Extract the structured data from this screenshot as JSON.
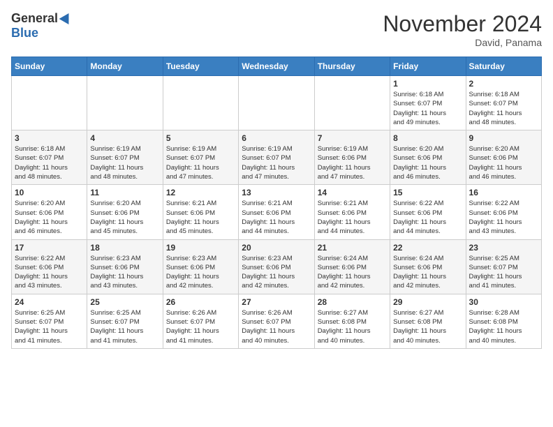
{
  "header": {
    "logo_general": "General",
    "logo_blue": "Blue",
    "month_title": "November 2024",
    "location": "David, Panama"
  },
  "days_of_week": [
    "Sunday",
    "Monday",
    "Tuesday",
    "Wednesday",
    "Thursday",
    "Friday",
    "Saturday"
  ],
  "weeks": [
    [
      {
        "day": "",
        "info": ""
      },
      {
        "day": "",
        "info": ""
      },
      {
        "day": "",
        "info": ""
      },
      {
        "day": "",
        "info": ""
      },
      {
        "day": "",
        "info": ""
      },
      {
        "day": "1",
        "info": "Sunrise: 6:18 AM\nSunset: 6:07 PM\nDaylight: 11 hours\nand 49 minutes."
      },
      {
        "day": "2",
        "info": "Sunrise: 6:18 AM\nSunset: 6:07 PM\nDaylight: 11 hours\nand 48 minutes."
      }
    ],
    [
      {
        "day": "3",
        "info": "Sunrise: 6:18 AM\nSunset: 6:07 PM\nDaylight: 11 hours\nand 48 minutes."
      },
      {
        "day": "4",
        "info": "Sunrise: 6:19 AM\nSunset: 6:07 PM\nDaylight: 11 hours\nand 48 minutes."
      },
      {
        "day": "5",
        "info": "Sunrise: 6:19 AM\nSunset: 6:07 PM\nDaylight: 11 hours\nand 47 minutes."
      },
      {
        "day": "6",
        "info": "Sunrise: 6:19 AM\nSunset: 6:07 PM\nDaylight: 11 hours\nand 47 minutes."
      },
      {
        "day": "7",
        "info": "Sunrise: 6:19 AM\nSunset: 6:06 PM\nDaylight: 11 hours\nand 47 minutes."
      },
      {
        "day": "8",
        "info": "Sunrise: 6:20 AM\nSunset: 6:06 PM\nDaylight: 11 hours\nand 46 minutes."
      },
      {
        "day": "9",
        "info": "Sunrise: 6:20 AM\nSunset: 6:06 PM\nDaylight: 11 hours\nand 46 minutes."
      }
    ],
    [
      {
        "day": "10",
        "info": "Sunrise: 6:20 AM\nSunset: 6:06 PM\nDaylight: 11 hours\nand 46 minutes."
      },
      {
        "day": "11",
        "info": "Sunrise: 6:20 AM\nSunset: 6:06 PM\nDaylight: 11 hours\nand 45 minutes."
      },
      {
        "day": "12",
        "info": "Sunrise: 6:21 AM\nSunset: 6:06 PM\nDaylight: 11 hours\nand 45 minutes."
      },
      {
        "day": "13",
        "info": "Sunrise: 6:21 AM\nSunset: 6:06 PM\nDaylight: 11 hours\nand 44 minutes."
      },
      {
        "day": "14",
        "info": "Sunrise: 6:21 AM\nSunset: 6:06 PM\nDaylight: 11 hours\nand 44 minutes."
      },
      {
        "day": "15",
        "info": "Sunrise: 6:22 AM\nSunset: 6:06 PM\nDaylight: 11 hours\nand 44 minutes."
      },
      {
        "day": "16",
        "info": "Sunrise: 6:22 AM\nSunset: 6:06 PM\nDaylight: 11 hours\nand 43 minutes."
      }
    ],
    [
      {
        "day": "17",
        "info": "Sunrise: 6:22 AM\nSunset: 6:06 PM\nDaylight: 11 hours\nand 43 minutes."
      },
      {
        "day": "18",
        "info": "Sunrise: 6:23 AM\nSunset: 6:06 PM\nDaylight: 11 hours\nand 43 minutes."
      },
      {
        "day": "19",
        "info": "Sunrise: 6:23 AM\nSunset: 6:06 PM\nDaylight: 11 hours\nand 42 minutes."
      },
      {
        "day": "20",
        "info": "Sunrise: 6:23 AM\nSunset: 6:06 PM\nDaylight: 11 hours\nand 42 minutes."
      },
      {
        "day": "21",
        "info": "Sunrise: 6:24 AM\nSunset: 6:06 PM\nDaylight: 11 hours\nand 42 minutes."
      },
      {
        "day": "22",
        "info": "Sunrise: 6:24 AM\nSunset: 6:06 PM\nDaylight: 11 hours\nand 42 minutes."
      },
      {
        "day": "23",
        "info": "Sunrise: 6:25 AM\nSunset: 6:07 PM\nDaylight: 11 hours\nand 41 minutes."
      }
    ],
    [
      {
        "day": "24",
        "info": "Sunrise: 6:25 AM\nSunset: 6:07 PM\nDaylight: 11 hours\nand 41 minutes."
      },
      {
        "day": "25",
        "info": "Sunrise: 6:25 AM\nSunset: 6:07 PM\nDaylight: 11 hours\nand 41 minutes."
      },
      {
        "day": "26",
        "info": "Sunrise: 6:26 AM\nSunset: 6:07 PM\nDaylight: 11 hours\nand 41 minutes."
      },
      {
        "day": "27",
        "info": "Sunrise: 6:26 AM\nSunset: 6:07 PM\nDaylight: 11 hours\nand 40 minutes."
      },
      {
        "day": "28",
        "info": "Sunrise: 6:27 AM\nSunset: 6:08 PM\nDaylight: 11 hours\nand 40 minutes."
      },
      {
        "day": "29",
        "info": "Sunrise: 6:27 AM\nSunset: 6:08 PM\nDaylight: 11 hours\nand 40 minutes."
      },
      {
        "day": "30",
        "info": "Sunrise: 6:28 AM\nSunset: 6:08 PM\nDaylight: 11 hours\nand 40 minutes."
      }
    ]
  ]
}
